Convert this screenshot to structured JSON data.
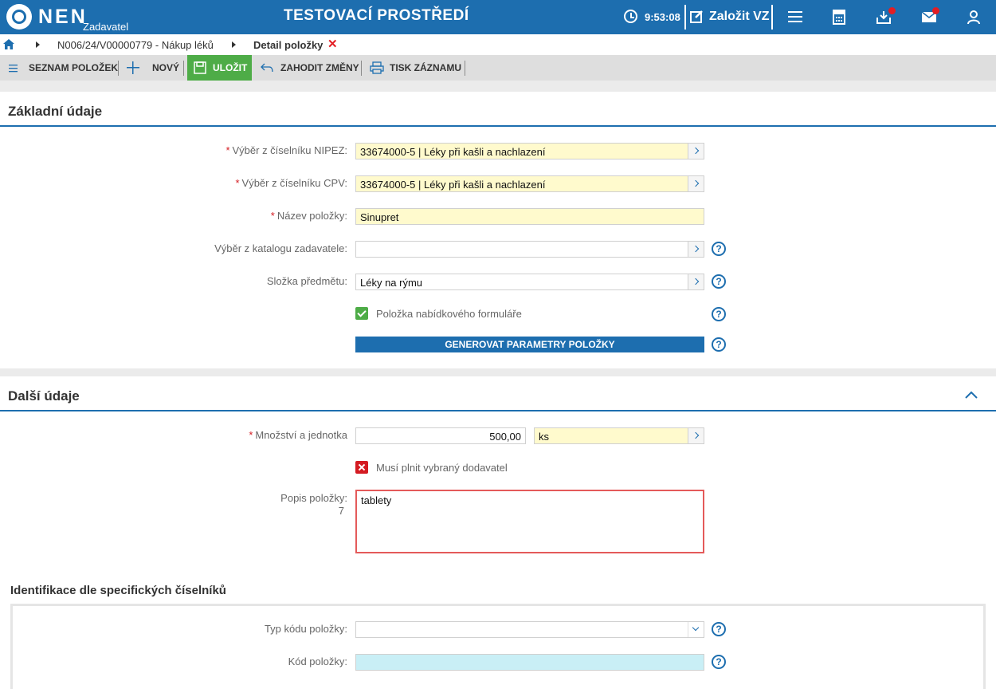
{
  "header": {
    "brand": "NEN",
    "role": "Zadavatel",
    "environment": "TESTOVACÍ PROSTŘEDÍ",
    "time": "9:53:08",
    "new_tender": "Založit VZ",
    "icons": [
      "menu-icon",
      "calculator-icon",
      "inbox-icon",
      "mail-icon",
      "user-icon"
    ]
  },
  "breadcrumb": {
    "items": [
      "N006/24/V00000779 - Nákup léků",
      "Detail položky"
    ]
  },
  "toolbar": {
    "list_items": "SEZNAM POLOŽEK",
    "new": "NOVÝ",
    "save": "ULOŽIT",
    "discard": "ZAHODIT ZMĚNY",
    "print": "TISK ZÁZNAMU"
  },
  "basic": {
    "title": "Základní údaje",
    "nipez_label": "Výběr z číselníku NIPEZ:",
    "nipez_value": "33674000-5 | Léky při kašli a nachlazení",
    "cpv_label": "Výběr z číselníku CPV:",
    "cpv_value": "33674000-5 | Léky při kašli a nachlazení",
    "name_label": "Název položky:",
    "name_value": "Sinupret",
    "catalog_label": "Výběr z katalogu zadavatele:",
    "catalog_value": "",
    "folder_label": "Složka předmětu:",
    "folder_value": "Léky na rýmu",
    "offer_form_label": "Položka nabídkového formuláře",
    "offer_form_checked": true,
    "generate_button": "GENEROVAT PARAMETRY POLOŽKY"
  },
  "other": {
    "title": "Další údaje",
    "quantity_label": "Množství a jednotka",
    "quantity_value": "500,00",
    "unit_value": "ks",
    "supplier_label": "Musí plnit vybraný dodavatel",
    "supplier_checked": false,
    "description_label": "Popis položky:",
    "description_count": "7",
    "description_value": "tablety",
    "ident_title": "Identifikace dle specifických číselníků",
    "code_type_label": "Typ kódu položky:",
    "code_type_value": "",
    "code_label": "Kód položky:",
    "code_value": ""
  },
  "colors": {
    "primary": "#1d6eaf",
    "save_green": "#4eac47",
    "required_red": "#d41b22",
    "required_bg": "#fffacd"
  }
}
